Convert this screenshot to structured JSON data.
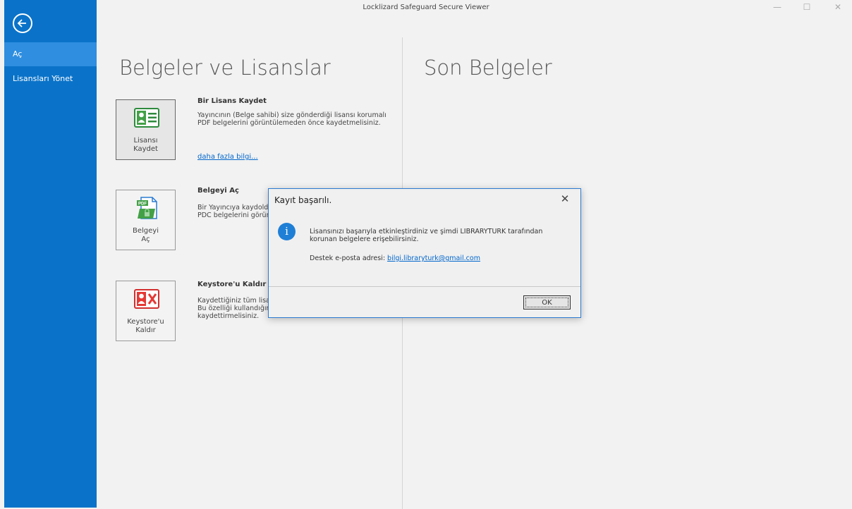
{
  "window": {
    "title": "Locklizard Safeguard Secure Viewer",
    "controls": {
      "minimize": "—",
      "maximize": "☐",
      "close": "✕"
    }
  },
  "sidebar": {
    "back_icon": "back-arrow-icon",
    "items": [
      {
        "label": "Aç",
        "active": true
      },
      {
        "label": "Lisansları Yönet",
        "active": false
      }
    ],
    "color": "#0a73c9"
  },
  "left_panel": {
    "heading": "Belgeler ve Lisanslar",
    "sections": [
      {
        "tile_label_1": "Lisansı",
        "tile_label_2": "Kaydet",
        "icon": "license-card-icon",
        "title": "Bir Lisans Kaydet",
        "desc": "Yayıncının (Belge sahibi) size gönderdiği lisansı korumalı\nPDF belgelerini görüntülemeden önce kaydetmelisiniz.",
        "link": "daha fazla bilgi..."
      },
      {
        "tile_label_1": "Belgeyi",
        "tile_label_2": "Aç",
        "icon": "pdf-file-lock-icon",
        "title": "Belgeyi Aç",
        "desc": "Bir Yayıncıya kaydoldu\nPDC belgelerini görünt"
      },
      {
        "tile_label_1": "Keystore'u",
        "tile_label_2": "Kaldır",
        "icon": "remove-keystore-icon",
        "title": "Keystore'u Kaldır",
        "desc": "Kaydettiğiniz tüm lisan\nBu özelliği kullandığınız\nkaydettirmelisiniz."
      }
    ]
  },
  "right_panel": {
    "heading": "Son Belgeler"
  },
  "dialog": {
    "title": "Kayıt başarılı.",
    "close": "✕",
    "icon": "info-icon",
    "icon_glyph": "i",
    "message": "Lisansınızı başarıyla etkinleştirdiniz ve şimdi LIBRARYTURK tarafından korunan belgelere erişebilirsiniz.",
    "support_label": "Destek e-posta adresi: ",
    "support_email": "bilgi.libraryturk@gmail.com",
    "ok_label": "OK"
  }
}
